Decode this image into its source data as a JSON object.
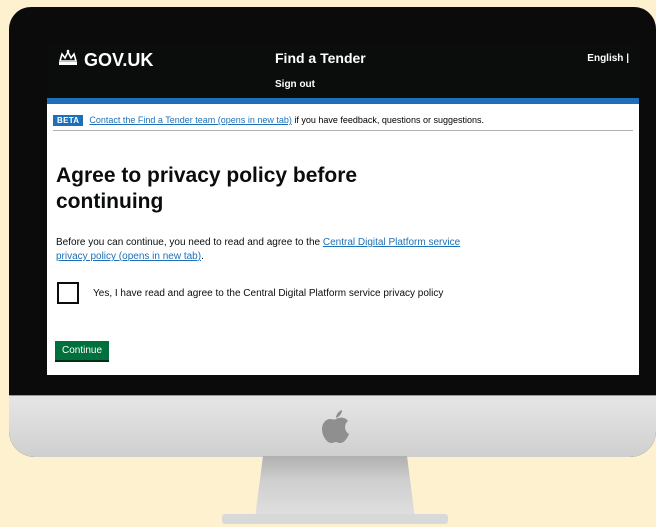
{
  "header": {
    "logo_text": "GOV.UK",
    "service_name": "Find a Tender",
    "sign_out": "Sign out",
    "language": "English |"
  },
  "beta_banner": {
    "tag": "BETA",
    "link": "Contact the Find a Tender team (opens in new tab)",
    "text": "if you have feedback, questions or suggestions."
  },
  "main": {
    "title": "Agree to privacy policy before continuing",
    "intro_text": "Before you can continue, you need to read and agree to the",
    "intro_link": "Central Digital Platform service privacy policy (opens in new tab)",
    "intro_end": ".",
    "checkbox_label": "Yes, I have read and agree to the Central Digital Platform service privacy policy",
    "checkbox_checked": false,
    "continue_label": "Continue"
  },
  "colors": {
    "header_bg": "#0b0c0c",
    "link": "#1d70b8",
    "button": "#00703c",
    "background": "#fdf1d0"
  },
  "icons": {
    "logo": "crown-icon",
    "device": "apple-logo-icon"
  }
}
